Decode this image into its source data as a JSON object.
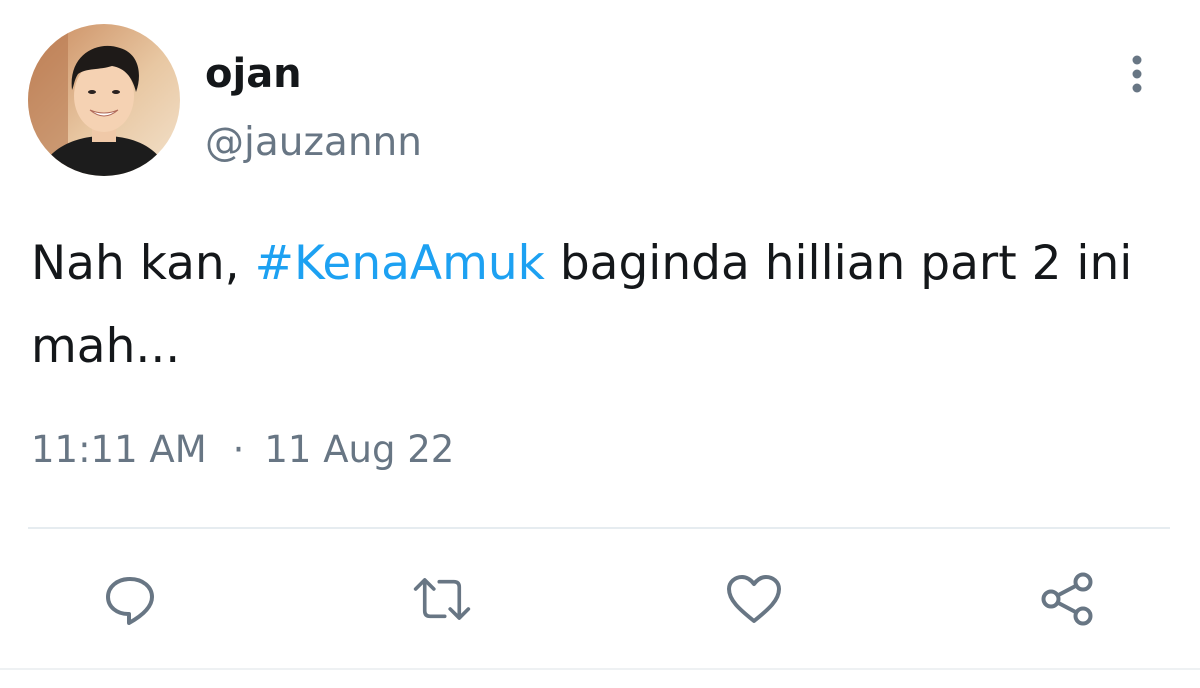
{
  "user": {
    "display_name": "ojan",
    "handle": "@jauzannn",
    "avatar_icon": "profile-photo"
  },
  "tweet": {
    "text_before": "Nah kan, ",
    "hashtag": "#KenaAmuk",
    "text_after": " baginda hillian part 2 ini mah...",
    "time": "11:11 AM",
    "separator": "·",
    "date": "11 Aug 22"
  },
  "actions": [
    {
      "name": "reply",
      "icon": "comment-icon"
    },
    {
      "name": "retweet",
      "icon": "retweet-icon"
    },
    {
      "name": "like",
      "icon": "heart-icon"
    },
    {
      "name": "share",
      "icon": "share-icon"
    }
  ],
  "colors": {
    "text": "#14171a",
    "secondary": "#687684",
    "hashtag": "#1da1f2",
    "divider": "#e6ecf0"
  }
}
